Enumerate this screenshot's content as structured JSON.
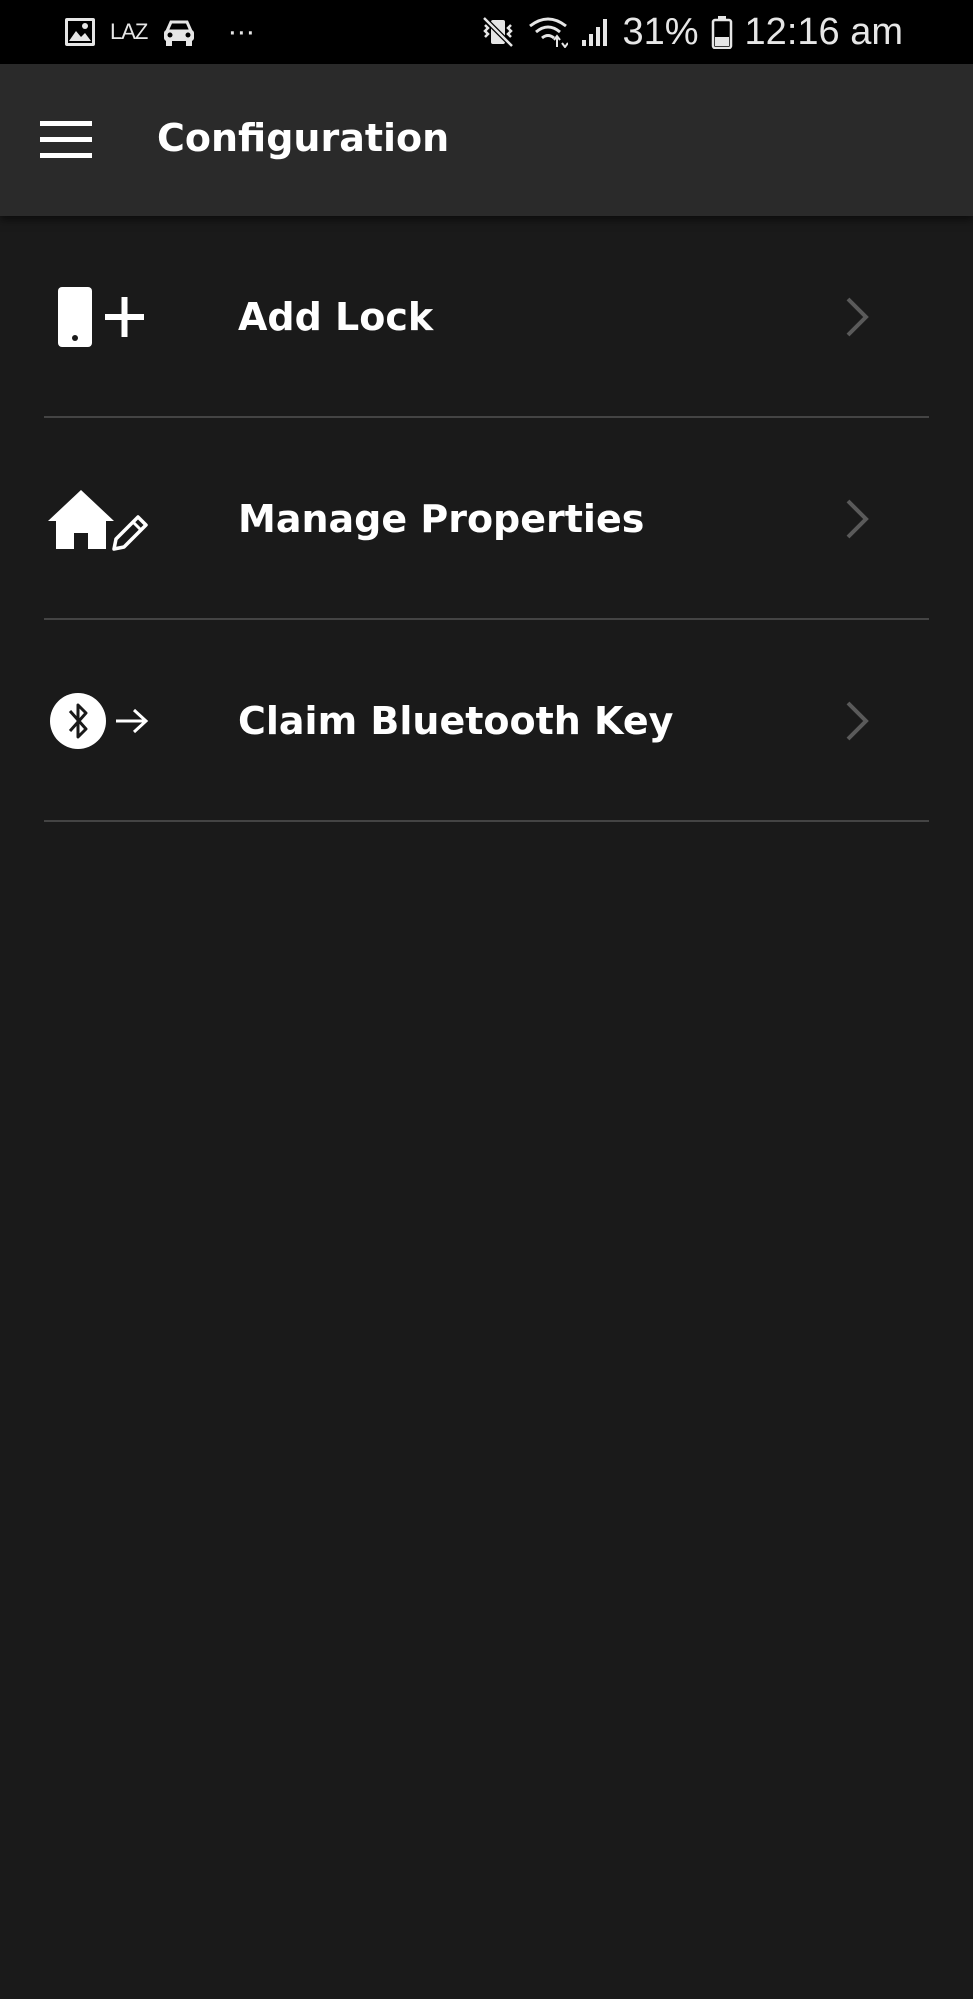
{
  "status_bar": {
    "icons_left": [
      "image-icon",
      "laz-icon",
      "car-icon",
      "more-dots-icon"
    ],
    "laz_label": "LAZ",
    "dots_label": "···",
    "icons_right": [
      "vibrate-mute-icon",
      "wifi-icon",
      "signal-icon",
      "battery-icon"
    ],
    "battery": "31%",
    "time": "12:16 am"
  },
  "app_bar": {
    "menu_icon": "hamburger-menu-icon",
    "title": "Configuration"
  },
  "menu": {
    "items": [
      {
        "label": "Add Lock",
        "icon": "add-lock-icon"
      },
      {
        "label": "Manage Properties",
        "icon": "house-edit-icon"
      },
      {
        "label": "Claim Bluetooth Key",
        "icon": "bluetooth-claim-icon"
      }
    ],
    "chevron_icon": "chevron-right-icon"
  },
  "colors": {
    "background": "#1a1a1a",
    "app_bar": "#2a2a2a",
    "status_bar": "#000000",
    "divider": "#444444",
    "chevron": "#5a5a5a",
    "text": "#ffffff"
  }
}
